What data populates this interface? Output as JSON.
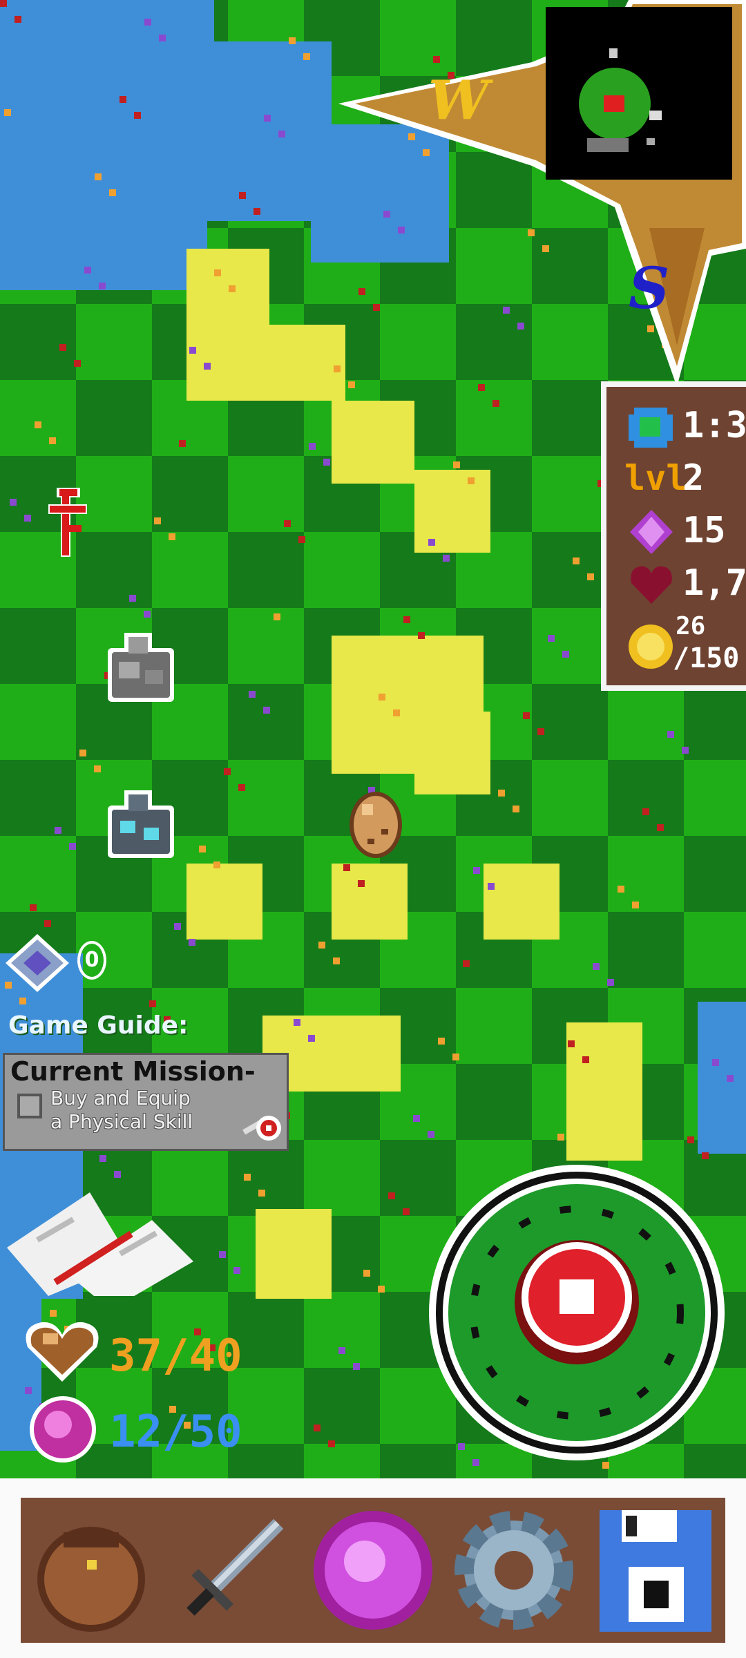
{
  "compass": {
    "west_label": "W",
    "south_label": "S"
  },
  "stats": {
    "area": "1:3",
    "level_icon": "lvl",
    "level": "2",
    "gems": "15",
    "health_multiplier": "1,7",
    "coins_line1": "26",
    "coins_line2": "/150"
  },
  "crystal": {
    "count": "0"
  },
  "guide": {
    "title": "Game Guide:",
    "mission_title": "Current Mission-",
    "mission_line1": "Buy and Equip",
    "mission_line2": "a Physical Skill"
  },
  "hud": {
    "health": "37/40",
    "mana": "12/50"
  },
  "toolbar": {
    "items": [
      "bag-icon",
      "sword-icon",
      "magic-orb-icon",
      "gear-icon",
      "save-disk-icon"
    ]
  },
  "colors": {
    "grass": "#1fae17",
    "grass_dark": "#157a1a",
    "sand": "#e8e84a",
    "water": "#3f8fd8",
    "panel_brown": "#6e4331",
    "health_orange": "#f0a020",
    "mana_blue": "#3a8ff0",
    "attack_red": "#e0202a"
  }
}
